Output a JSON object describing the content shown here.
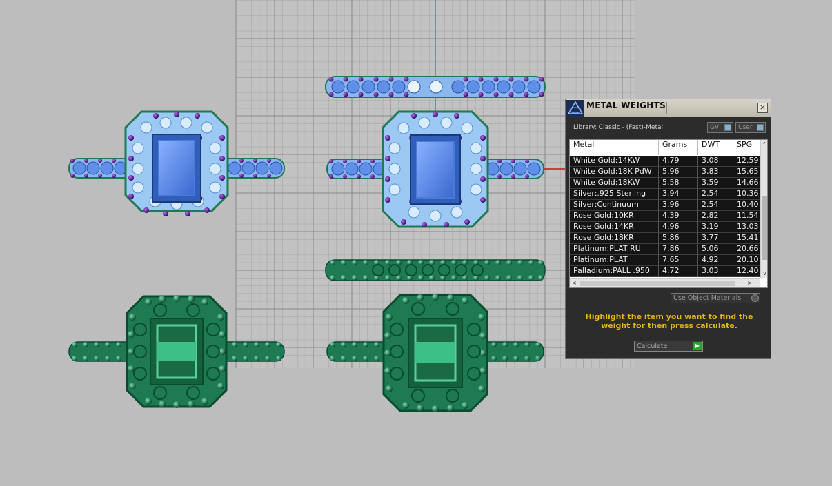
{
  "panel": {
    "title": "METAL WEIGHTS",
    "close_glyph": "☒",
    "library_label": "Library: Classic - (Fast)-Metal",
    "gv_label": "GV",
    "user_label": "User",
    "columns": [
      "Metal",
      "Grams",
      "DWT",
      "SPG"
    ],
    "rows": [
      [
        "White Gold:14KW",
        "4.79",
        "3.08",
        "12.59"
      ],
      [
        "White Gold:18K PdW",
        "5.96",
        "3.83",
        "15.65"
      ],
      [
        "White Gold:18KW",
        "5.58",
        "3.59",
        "14.66"
      ],
      [
        "Silver:.925 Sterling",
        "3.94",
        "2.54",
        "10.36"
      ],
      [
        "Silver:Continuum",
        "3.96",
        "2.54",
        "10.40"
      ],
      [
        "Rose Gold:10KR",
        "4.39",
        "2.82",
        "11.54"
      ],
      [
        "Rose Gold:14KR",
        "4.96",
        "3.19",
        "13.03"
      ],
      [
        "Rose Gold:18KR",
        "5.86",
        "3.77",
        "15.41"
      ],
      [
        "Platinum:PLAT RU",
        "7.86",
        "5.06",
        "20.66"
      ],
      [
        "Platinum:PLAT",
        "7.65",
        "4.92",
        "20.10"
      ],
      [
        "Palladium:PALL .950",
        "4.72",
        "3.03",
        "12.40"
      ]
    ],
    "use_object_materials_label": "Use Object Materials",
    "instructions": "Highlight the item you want to find the weight for then press calculate.",
    "calculate_label": "Calculate"
  },
  "icons": {
    "logo": "app-logo-icon",
    "close": "close-icon",
    "calculate": "play-arrow-icon"
  },
  "colors": {
    "gem_blue": "#5f8fe8",
    "halo_light": "#9cc8f4",
    "accent_purple": "#6a1fa0",
    "metal_green": "#1e7a52",
    "instructions_text": "#e8b810"
  }
}
